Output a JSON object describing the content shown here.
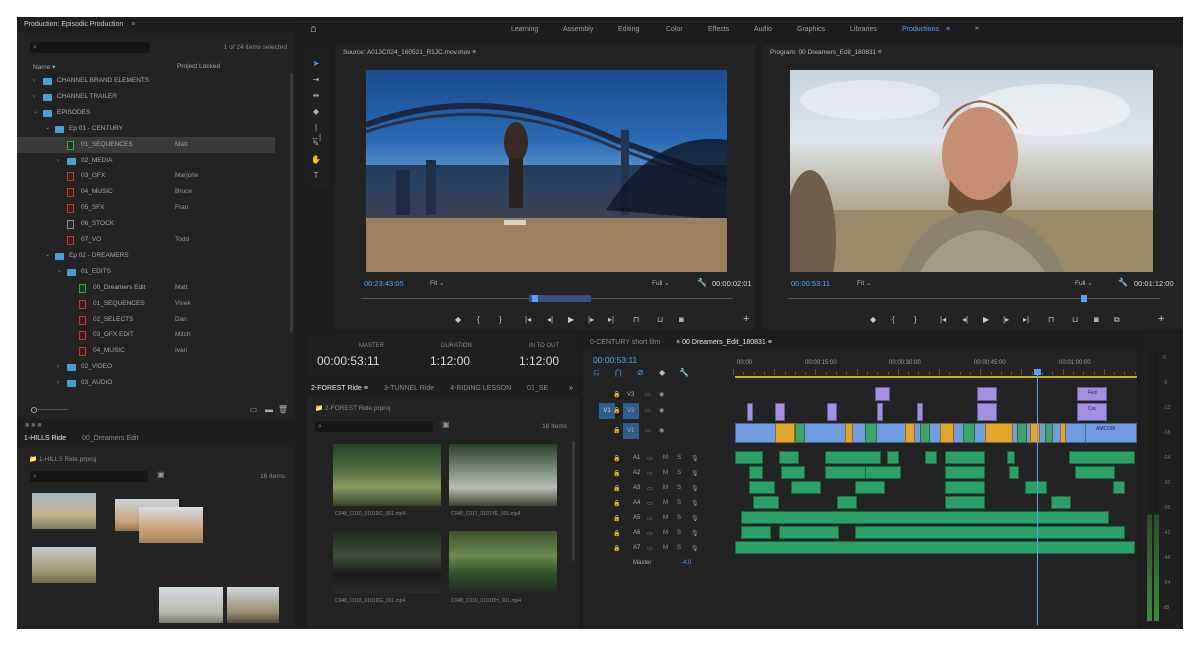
{
  "project_panel": {
    "title": "Production: Episodic Production",
    "items_selected": "1 of 24 items selected",
    "col_name": "Name",
    "col_locked": "Project Locked",
    "rows": [
      {
        "name": "CHANNEL BRAND ELEMENTS",
        "owner": "",
        "type": "folder",
        "indent": 0,
        "open": false
      },
      {
        "name": "CHANNEL TRAILER",
        "owner": "",
        "type": "folder",
        "indent": 0,
        "open": false
      },
      {
        "name": "EPISODES",
        "owner": "",
        "type": "folder",
        "indent": 0,
        "open": true
      },
      {
        "name": "Ep 01 - CENTURY",
        "owner": "",
        "type": "folder",
        "indent": 1,
        "open": true
      },
      {
        "name": "01_SEQUENCES",
        "owner": "Matt",
        "type": "seq-green",
        "indent": 2,
        "open": false
      },
      {
        "name": "02_MEDIA",
        "owner": "",
        "type": "folder",
        "indent": 2,
        "open": false
      },
      {
        "name": "03_GFX",
        "owner": "Marjorie",
        "type": "seq",
        "indent": 2,
        "open": false
      },
      {
        "name": "04_MUSIC",
        "owner": "Bruce",
        "type": "seq",
        "indent": 2,
        "open": false
      },
      {
        "name": "05_SFX",
        "owner": "Fran",
        "type": "seq",
        "indent": 2,
        "open": false
      },
      {
        "name": "06_STOCK",
        "owner": "",
        "type": "seq-plain",
        "indent": 2,
        "open": false
      },
      {
        "name": "07_VO",
        "owner": "Todd",
        "type": "seq",
        "indent": 2,
        "open": false
      },
      {
        "name": "Ep 02 - DREAMERS",
        "owner": "",
        "type": "folder",
        "indent": 1,
        "open": true
      },
      {
        "name": "01_EDITS",
        "owner": "",
        "type": "folder",
        "indent": 2,
        "open": true
      },
      {
        "name": "00_Dreamers Edit",
        "owner": "Matt",
        "type": "seq-green",
        "indent": 3,
        "open": false
      },
      {
        "name": "01_SEQUENCES",
        "owner": "Vivek",
        "type": "seq",
        "indent": 3,
        "open": false
      },
      {
        "name": "02_SELECTS",
        "owner": "Dan",
        "type": "seq",
        "indent": 3,
        "open": false
      },
      {
        "name": "03_GFX EDIT",
        "owner": "Mitch",
        "type": "seq",
        "indent": 3,
        "open": false
      },
      {
        "name": "04_MUSIC",
        "owner": "Ivan",
        "type": "seq",
        "indent": 3,
        "open": false
      },
      {
        "name": "02_VIDEO",
        "owner": "",
        "type": "folder",
        "indent": 2,
        "open": false
      },
      {
        "name": "03_AUDIO",
        "owner": "",
        "type": "folder",
        "indent": 2,
        "open": false
      }
    ]
  },
  "bin_panel": {
    "tab1": "1-HILLS Ride",
    "tab2": "00_Dreamers Edit",
    "path": "1-HILLS Ride.prproj",
    "count": "16 Items"
  },
  "workspaces": [
    "Learning",
    "Assembly",
    "Editing",
    "Color",
    "Effects",
    "Audio",
    "Graphics",
    "Libraries",
    "Productions"
  ],
  "active_workspace": "Productions",
  "source_monitor": {
    "title": "Source: A013C024_160521_R1JC.mov.mov",
    "timecode_in": "00:23:43:05",
    "fit": "Fit",
    "quality": "Full",
    "timecode_out": "00:00:02:01"
  },
  "program_monitor": {
    "title": "Program: 00 Dreamers_Edit_180831",
    "timecode_in": "00:00:53:11",
    "fit": "Fit",
    "quality": "Full",
    "timecode_out": "00:01:12:00"
  },
  "info_panel": {
    "master_label": "MASTER",
    "master_value": "00:00:53:11",
    "duration_label": "DURATION",
    "duration_value": "1:12:00",
    "inout_label": "IN TO OUT",
    "inout_value": "1:12:00"
  },
  "media_bin": {
    "tabs": [
      "2-FOREST Ride",
      "3-TUNNEL Ride",
      "4-RIDING LESSON",
      "01_SE"
    ],
    "path": "2-FOREST Ride.prproj",
    "count": "16 Items",
    "clips": [
      "C048_C010_0101DC_001.mp4",
      "C048_C017_0101YE_001.mp4",
      "C048_C018_0101DG_001.mp4",
      "C048_C019_0101DH_001.mp4"
    ]
  },
  "timeline": {
    "tab1": "0-CENTURY short film",
    "tab2": "00 Dreamers_Edit_180831",
    "timecode": "00:00:53:11",
    "ruler": [
      "00:00",
      "00:00:15:00",
      "00:00:30:00",
      "00:00:45:00",
      "00:01:00:00"
    ],
    "video_tracks": [
      "V3",
      "V2",
      "V1"
    ],
    "audio_tracks": [
      "A1",
      "A2",
      "A3",
      "A4",
      "A5",
      "A6",
      "A7"
    ],
    "master_label": "Master",
    "master_value": "-4.0",
    "clip_labels": [
      "Fed",
      "Cro",
      "AMCOM"
    ]
  },
  "meter_ticks": [
    "0",
    "-6",
    "-12",
    "-18",
    "-24",
    "-30",
    "-36",
    "-42",
    "-48",
    "-54",
    "dB"
  ]
}
